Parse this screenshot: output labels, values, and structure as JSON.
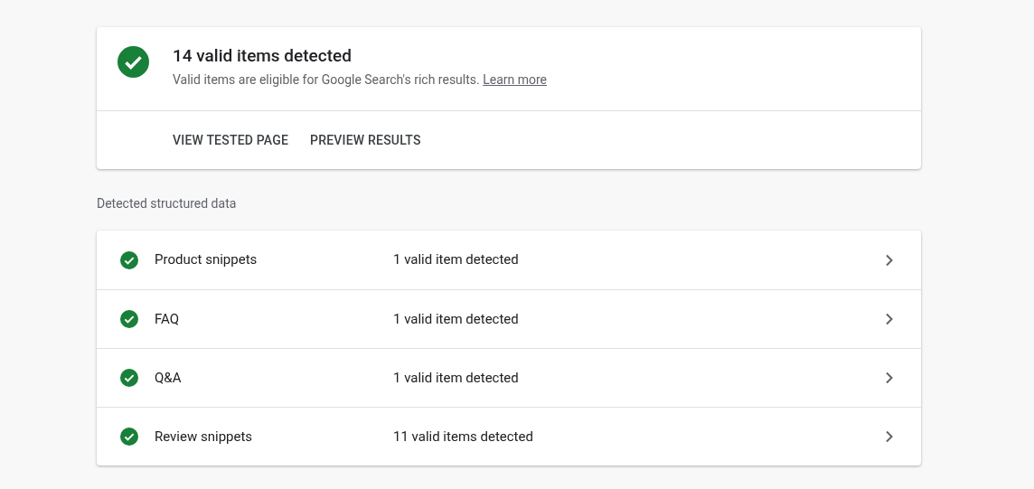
{
  "summary": {
    "kind": "valid",
    "title": "14 valid items detected",
    "description": "Valid items are eligible for Google Search's rich results.",
    "link": "Learn more"
  },
  "actions": [
    "VIEW TESTED PAGE",
    "PREVIEW RESULTS"
  ],
  "section_title": "Detected structured data",
  "items": [
    {
      "kind": "valid",
      "name": "Product snippets",
      "count": "1 valid item detected"
    },
    {
      "kind": "valid",
      "name": "FAQ",
      "count": "1 valid item detected"
    },
    {
      "kind": "valid",
      "name": "Q&A",
      "count": "1 valid item detected"
    },
    {
      "kind": "valid",
      "name": "Review snippets",
      "count": "11 valid items detected"
    }
  ]
}
